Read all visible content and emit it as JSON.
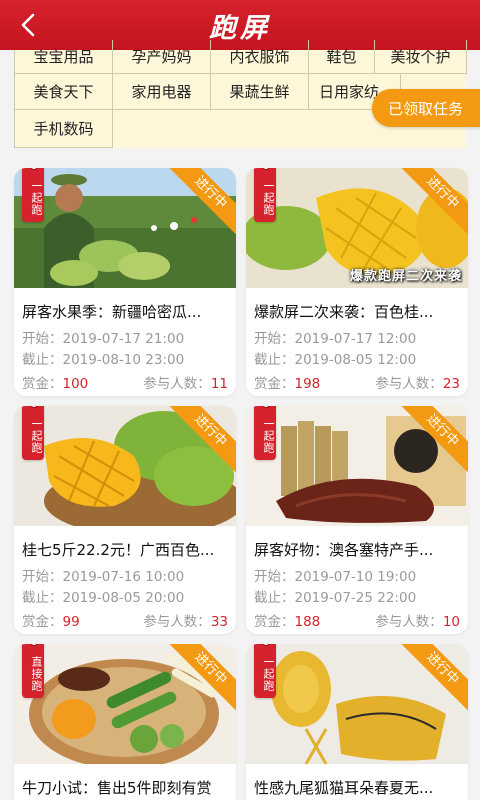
{
  "header": {
    "title": "跑屏"
  },
  "categories": [
    "宝宝用品",
    "孕产妈妈",
    "内衣服饰",
    "鞋包",
    "美妆个护",
    "美食天下",
    "家用电器",
    "果蔬生鲜",
    "日用家纺",
    "手机数码"
  ],
  "task_button": {
    "label": "已领取任务"
  },
  "labels": {
    "start": "开始：",
    "end": "截止：",
    "reward": "赏金：",
    "participants": "参与人数："
  },
  "cards": [
    {
      "title": "屏客水果季：新疆哈密瓜...",
      "ribbon": "进行中",
      "tag": "一起跑",
      "start": "2019-07-17 21:00",
      "end": "2019-08-10 23:00",
      "reward": "100",
      "participants": "11",
      "caption": ""
    },
    {
      "title": "爆款屏二次来袭：百色桂...",
      "ribbon": "进行中",
      "tag": "一起跑",
      "start": "2019-07-17 12:00",
      "end": "2019-08-05 12:00",
      "reward": "198",
      "participants": "23",
      "caption": "爆款跑屏二次来袭"
    },
    {
      "title": "桂七5斤22.2元！广西百色...",
      "ribbon": "进行中",
      "tag": "一起跑",
      "start": "2019-07-16 10:00",
      "end": "2019-08-05 20:00",
      "reward": "99",
      "participants": "33",
      "caption": ""
    },
    {
      "title": "屏客好物：澳各塞特产手...",
      "ribbon": "进行中",
      "tag": "一起跑",
      "start": "2019-07-10 19:00",
      "end": "2019-07-25 22:00",
      "reward": "188",
      "participants": "10",
      "caption": ""
    },
    {
      "title": "牛刀小试：售出5件即刻有赏",
      "ribbon": "进行中",
      "tag": "直接跑",
      "start": "",
      "end": "",
      "reward": "",
      "participants": "",
      "caption": ""
    },
    {
      "title": "性感九尾狐猫耳朵春夏无...",
      "ribbon": "进行中",
      "tag": "一起跑",
      "start": "",
      "end": "",
      "reward": "",
      "participants": "",
      "caption": ""
    }
  ]
}
